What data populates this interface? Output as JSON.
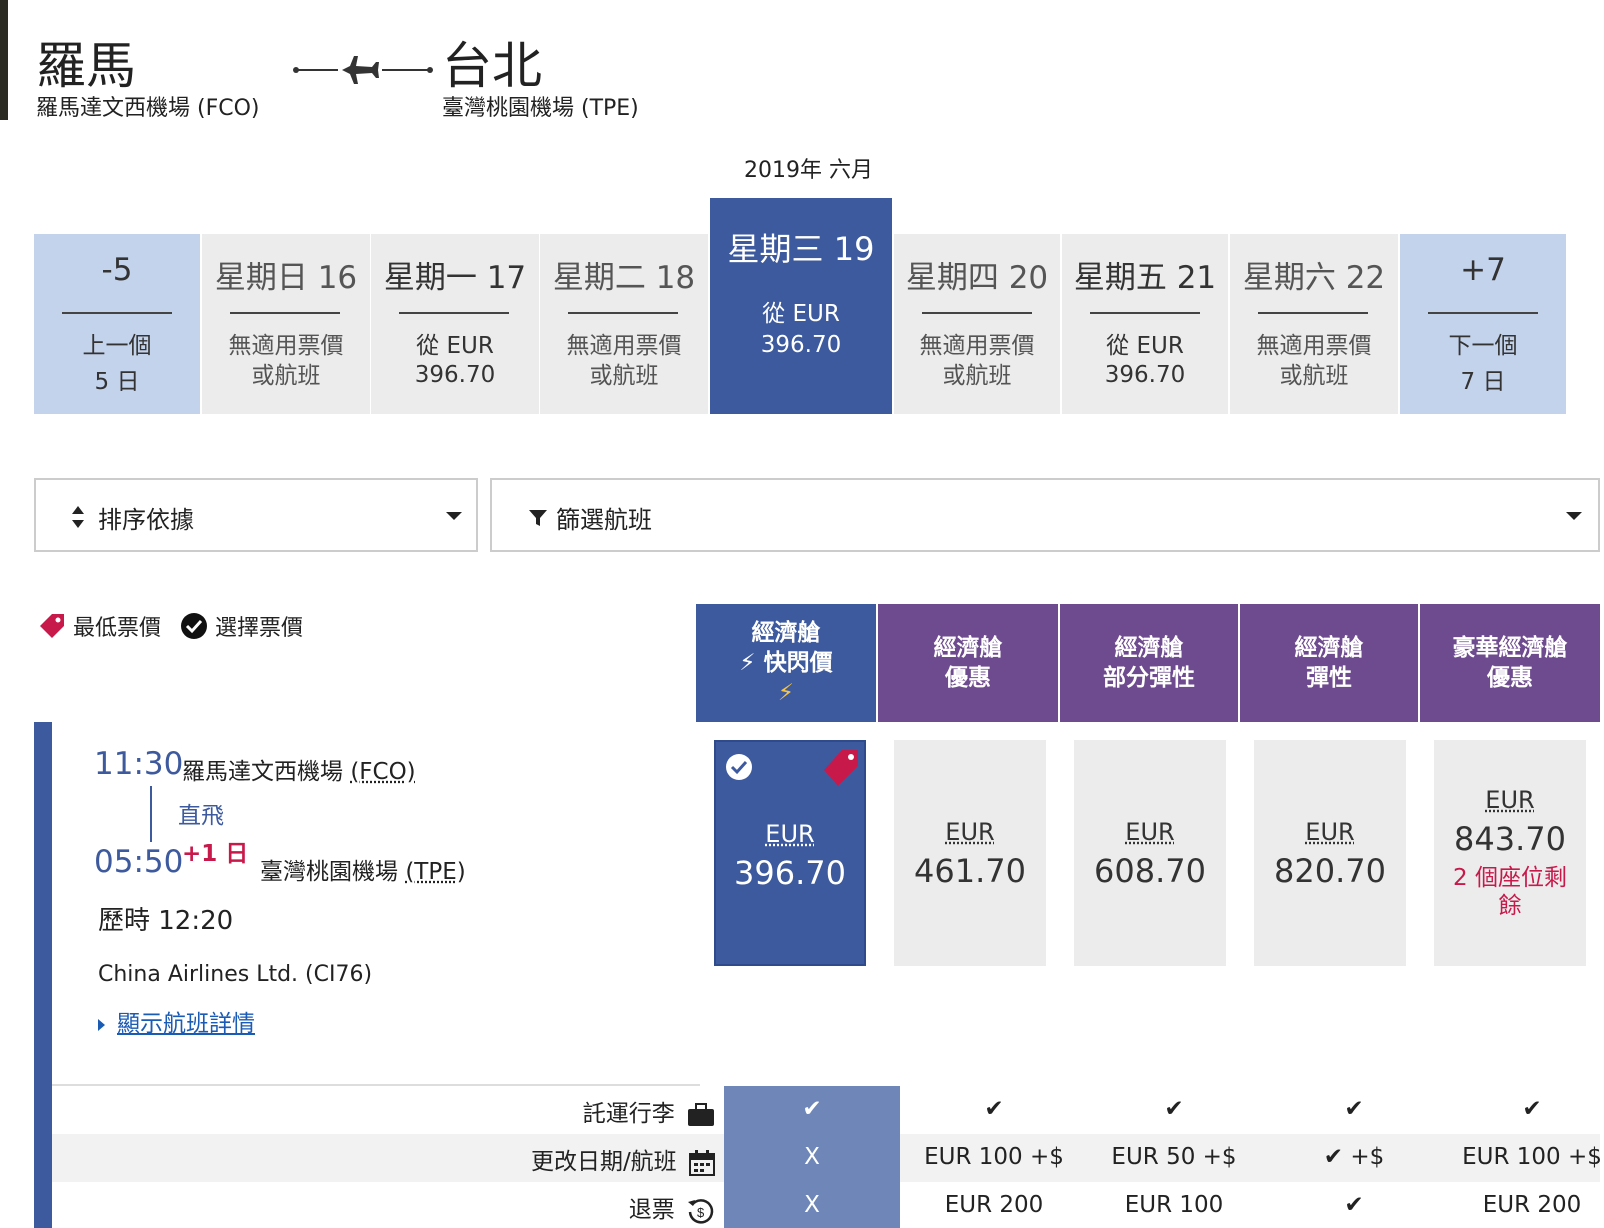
{
  "route": {
    "origin_city": "羅馬",
    "origin_airport": "羅馬達文西機場 (FCO)",
    "dest_city": "台北",
    "dest_airport": "臺灣桃園機場 (TPE)"
  },
  "calendar": {
    "month": "2019年 六月",
    "prev": {
      "head": "-5",
      "line1": "上一個",
      "line2": "5 日"
    },
    "next": {
      "head": "+7",
      "line1": "下一個",
      "line2": "7 日"
    },
    "days": [
      {
        "head": "星期日 16",
        "line1": "無適用票價",
        "line2": "或航班"
      },
      {
        "head": "星期一 17",
        "line1": "從 EUR",
        "line2": "396.70"
      },
      {
        "head": "星期二 18",
        "line1": "無適用票價",
        "line2": "或航班"
      },
      {
        "head": "星期三 19",
        "line1": "從 EUR",
        "line2": "396.70"
      },
      {
        "head": "星期四 20",
        "line1": "無適用票價",
        "line2": "或航班"
      },
      {
        "head": "星期五 21",
        "line1": "從 EUR",
        "line2": "396.70"
      },
      {
        "head": "星期六 22",
        "line1": "無適用票價",
        "line2": "或航班"
      }
    ]
  },
  "controls": {
    "sort_label": "排序依據",
    "filter_label": "篩選航班"
  },
  "legend": {
    "lowest": "最低票價",
    "selected": "選擇票價"
  },
  "fare_classes": [
    {
      "line1": "經濟艙",
      "line2": "⚡ 快閃價",
      "line3": "⚡"
    },
    {
      "line1": "經濟艙",
      "line2": "優惠",
      "line3": ""
    },
    {
      "line1": "經濟艙",
      "line2": "部分彈性",
      "line3": ""
    },
    {
      "line1": "經濟艙",
      "line2": "彈性",
      "line3": ""
    },
    {
      "line1": "豪華經濟艙",
      "line2": "優惠",
      "line3": ""
    }
  ],
  "flight": {
    "depart_time": "11:30",
    "depart_airport": "羅馬達文西機場",
    "depart_code": "(FCO)",
    "stops": "直飛",
    "arrive_time": "05:50",
    "day_offset": "+1 日",
    "arrive_airport": "臺灣桃園機場",
    "arrive_code": "(TPE)",
    "duration": "歷時 12:20",
    "airline": "China Airlines Ltd. (CI76)",
    "details_link": "顯示航班詳情"
  },
  "fares": [
    {
      "currency": "EUR",
      "amount": "396.70",
      "seats": ""
    },
    {
      "currency": "EUR",
      "amount": "461.70",
      "seats": ""
    },
    {
      "currency": "EUR",
      "amount": "608.70",
      "seats": ""
    },
    {
      "currency": "EUR",
      "amount": "820.70",
      "seats": ""
    },
    {
      "currency": "EUR",
      "amount": "843.70",
      "seats": "2 個座位剩餘"
    }
  ],
  "features": [
    {
      "label": "託運行李",
      "icon": "luggage-icon",
      "values": [
        "✔",
        "✔",
        "✔",
        "✔",
        "✔"
      ]
    },
    {
      "label": "更改日期/航班",
      "icon": "calendar-icon",
      "values": [
        "X",
        "EUR 100 +$",
        "EUR 50 +$",
        "✔ +$",
        "EUR 100 +$"
      ]
    },
    {
      "label": "退票",
      "icon": "refund-icon",
      "values": [
        "X",
        "EUR 200",
        "EUR 100",
        "✔",
        "EUR 200"
      ]
    }
  ],
  "colors": {
    "primary_blue": "#3d5a9e",
    "nav_blue": "#c4d3ec",
    "purple": "#6e4a8e",
    "accent_red": "#c8194b",
    "link": "#1a5bb5"
  }
}
